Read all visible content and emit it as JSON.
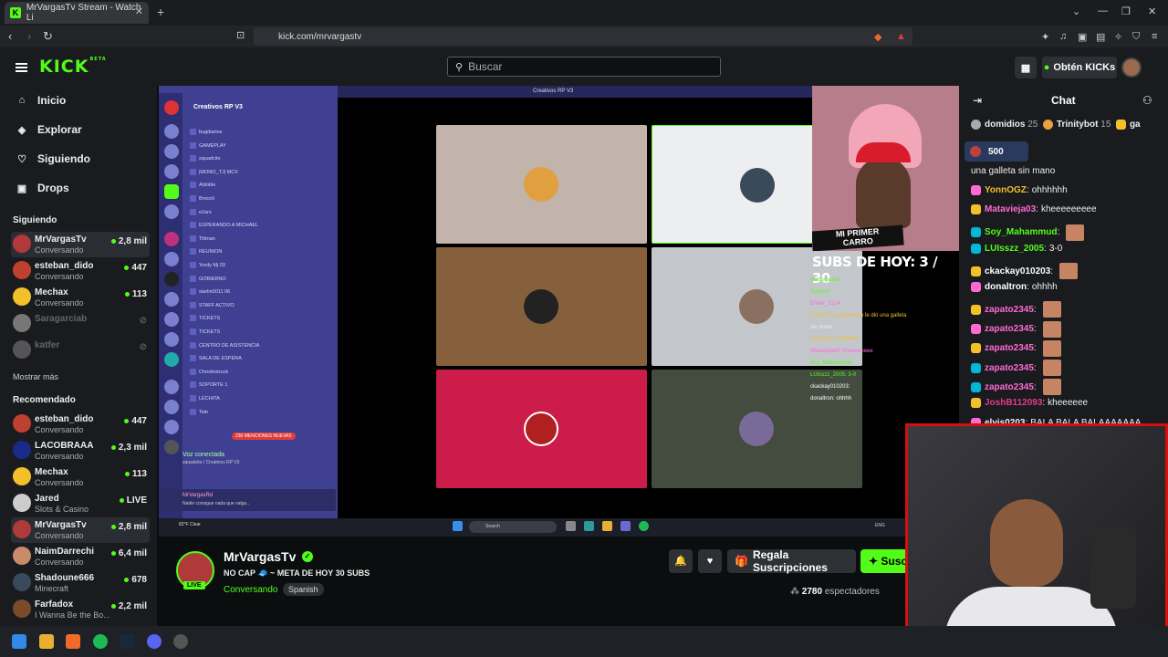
{
  "browser": {
    "tab_title": "MrVargasTv Stream - Watch Li",
    "url": "kick.com/mrvargastv"
  },
  "header": {
    "logo": "KICK",
    "logo_badge": "BETA",
    "search_placeholder": "Buscar",
    "get_kicks": "Obtén KICKs"
  },
  "sidebar": {
    "nav": [
      {
        "label": "Inicio",
        "icon": "home-icon"
      },
      {
        "label": "Explorar",
        "icon": "compass-icon"
      },
      {
        "label": "Siguiendo",
        "icon": "heart-icon"
      },
      {
        "label": "Drops",
        "icon": "drops-icon"
      }
    ],
    "following_title": "Siguiendo",
    "following": [
      {
        "name": "MrVargasTv",
        "category": "Conversando",
        "viewers": "2,8 mil"
      },
      {
        "name": "esteban_dido",
        "category": "Conversando",
        "viewers": "447"
      },
      {
        "name": "Mechax",
        "category": "Conversando",
        "viewers": "113"
      },
      {
        "name": "Saragarciab",
        "category": "",
        "viewers": ""
      },
      {
        "name": "katfer",
        "category": "",
        "viewers": ""
      }
    ],
    "show_more": "Mostrar más",
    "recommended_title": "Recomendado",
    "recommended": [
      {
        "name": "esteban_dido",
        "category": "Conversando",
        "viewers": "447"
      },
      {
        "name": "LACOBRAAA",
        "category": "Conversando",
        "viewers": "2,3 mil"
      },
      {
        "name": "Mechax",
        "category": "Conversando",
        "viewers": "113"
      },
      {
        "name": "Jared",
        "category": "Slots & Casino",
        "viewers": "LIVE"
      },
      {
        "name": "MrVargasTv",
        "category": "Conversando",
        "viewers": "2,8 mil"
      },
      {
        "name": "NaimDarrechi",
        "category": "Conversando",
        "viewers": "6,4 mil"
      },
      {
        "name": "Shadoune666",
        "category": "Minecraft",
        "viewers": "678"
      },
      {
        "name": "Farfadox",
        "category": "I Wanna Be the Bo...",
        "viewers": "2,2 mil"
      }
    ]
  },
  "video": {
    "discord_server": "Creativos RP V3",
    "discord_window_title": "Creativos RP V3",
    "channels": [
      "bugdiarios",
      "GAMEPLAY",
      "squadcito",
      "|MONO_TJ| MCX",
      "Aldoble",
      "Brocoli",
      "e2ars",
      "ESPERANDO A MICHAEL",
      "Tiltman",
      "REUNION",
      "Yordy Mj 03",
      "GOBIERNO",
      "starlin0011 06",
      "STAFF ACTIVO",
      "TICKETS",
      "TICKETS",
      "CENTRO DE ASISTENCIA",
      "SALA DE ESPERA",
      "Chrisfestruck",
      "SOPORTE 1",
      "LECHITA",
      "Tele"
    ],
    "mentions": "230 MENCIONES NUEVAS",
    "voice_connected": "Voz conectada",
    "voice_channel": "squadcito / Creativos RP V3",
    "discord_user": "MrVargasRd",
    "discord_status": "Nadie consigue nada que valga...",
    "weather": "82°F",
    "weather_desc": "Clear",
    "task_search": "Search",
    "tray_lang": "ENG",
    "cam_banner_1": "MI PRIMER",
    "cam_banner_2": "CARRO",
    "subs_goal": "SUBS DE HOY: 3 / 30",
    "overlay_chat": [
      "windsgamer",
      "7sdreco",
      "Ender_2124",
      "Azul012: uooooooeno le dió una galleta",
      "sin mano",
      "YonnOGZ: ohhhhhh",
      "Matavieja03: kheeeeeeee",
      "Soy_Mahammud:",
      "LUIsszz_2005: 3-0",
      "ckackay010203:",
      "donaltron: ohhhh"
    ]
  },
  "stream": {
    "name": "MrVargasTv",
    "title": "NO CAP 🧢 ~ META DE HOY 30 SUBS",
    "category": "Conversando",
    "language": "Spanish",
    "live": "LIVE",
    "gift_subs": "Regala Suscripciones",
    "subscribe": "Suscribirse",
    "viewers_count": "2780",
    "viewers_label": "espectadores"
  },
  "chat": {
    "title": "Chat",
    "top_gifters": [
      {
        "name": "domidios",
        "count": "25"
      },
      {
        "name": "Trinitybot",
        "count": "15"
      },
      {
        "name": "ga",
        "count": ""
      }
    ],
    "pinned_amount": "500",
    "messages": [
      {
        "user": "",
        "text": "una galleta sin mano",
        "color": "#eeeeee"
      },
      {
        "user": "YonnOGZ",
        "text": "ohhhhhh",
        "color": "#f2c029"
      },
      {
        "user": "Matavieja03",
        "text": "kheeeeeeeee",
        "color": "#ff6ad5"
      },
      {
        "user": "Soy_Mahammud",
        "text": "",
        "color": "#53fc18"
      },
      {
        "user": "LUIsszz_2005",
        "text": "3-0",
        "color": "#53fc18"
      },
      {
        "user": "ckackay010203",
        "text": "",
        "color": "#ffffff"
      },
      {
        "user": "donaltron",
        "text": "ohhhh",
        "color": "#ffffff"
      },
      {
        "user": "zapato2345",
        "text": "",
        "color": "#ff6ad5"
      },
      {
        "user": "zapato2345",
        "text": "",
        "color": "#ff6ad5"
      },
      {
        "user": "zapato2345",
        "text": "",
        "color": "#ff6ad5"
      },
      {
        "user": "zapato2345",
        "text": "",
        "color": "#ff6ad5"
      },
      {
        "user": "zapato2345",
        "text": "",
        "color": "#ff6ad5"
      },
      {
        "user": "JoshB112093",
        "text": "kheeeeee",
        "color": "#e23b8a"
      },
      {
        "user": "elvis0203",
        "text": "BALA BALA BALAAAAAAA",
        "color": "#eeeeee"
      }
    ]
  },
  "colors": {
    "brand": "#53fc18",
    "bg": "#0b0e0f",
    "panel": "#191b1f"
  }
}
